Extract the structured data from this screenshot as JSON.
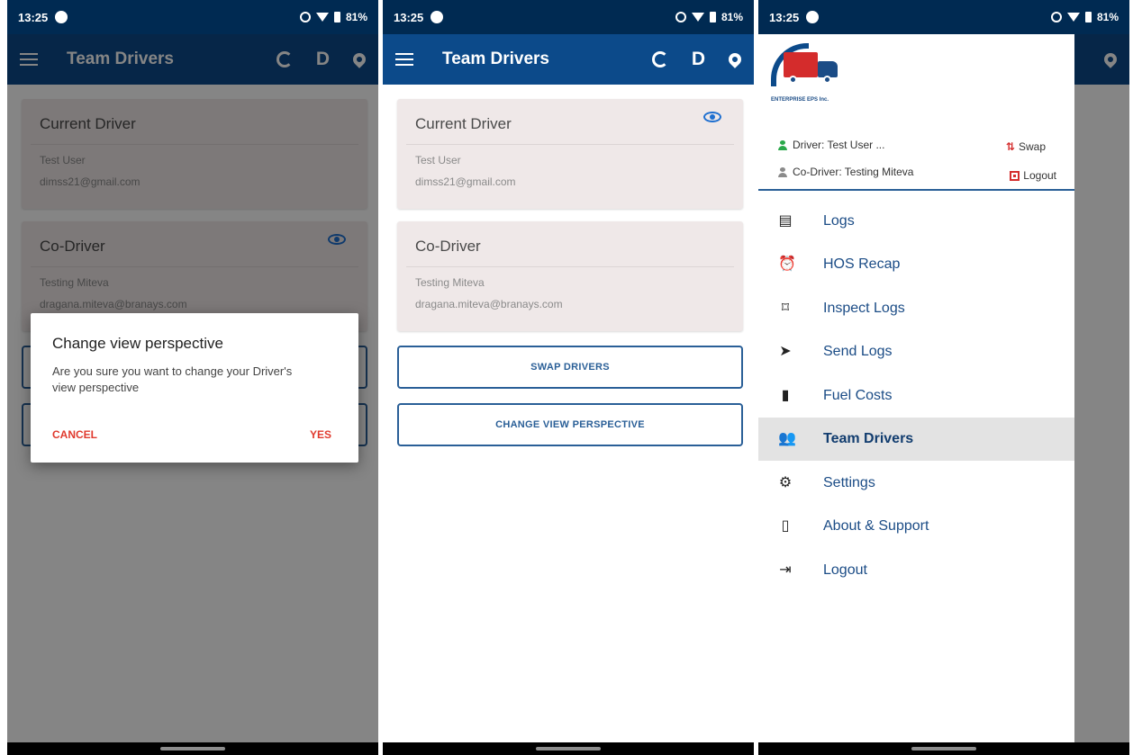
{
  "status": {
    "time": "13:25",
    "battery": "81%"
  },
  "panel1": {
    "appbar_title": "Team Drivers",
    "appbar_d": "D",
    "current_driver": {
      "title": "Current Driver",
      "name": "Test User",
      "email": "dimss21@gmail.com"
    },
    "co_driver": {
      "title": "Co-Driver",
      "name": "Testing Miteva",
      "email": "dragana.miteva@branays.com"
    },
    "dialog": {
      "title": "Change view perspective",
      "message": "Are you sure you want to change your Driver's view perspective",
      "cancel": "CANCEL",
      "yes": "YES"
    }
  },
  "panel2": {
    "appbar_title": "Team Drivers",
    "appbar_d": "D",
    "current_driver": {
      "title": "Current Driver",
      "name": "Test User",
      "email": "dimss21@gmail.com"
    },
    "co_driver": {
      "title": "Co-Driver",
      "name": "Testing Miteva",
      "email": "dragana.miteva@branays.com"
    },
    "swap_button": "SWAP DRIVERS",
    "change_view_button": "CHANGE VIEW PERSPECTIVE"
  },
  "panel3": {
    "company": "ENTERPRISE EPS Inc.",
    "driver": "Driver: Test User ...",
    "co_driver": "Co-Driver: Testing Miteva",
    "swap": "Swap",
    "logout_link": "Logout",
    "menu": [
      {
        "label": "Logs",
        "icon": "logs-icon"
      },
      {
        "label": "HOS Recap",
        "icon": "alarm-icon"
      },
      {
        "label": "Inspect Logs",
        "icon": "inspect-icon"
      },
      {
        "label": "Send Logs",
        "icon": "send-icon"
      },
      {
        "label": "Fuel Costs",
        "icon": "fuel-icon"
      },
      {
        "label": "Team Drivers",
        "icon": "team-icon"
      },
      {
        "label": "Settings",
        "icon": "gear-icon"
      },
      {
        "label": "About & Support",
        "icon": "phone-icon"
      },
      {
        "label": "Logout",
        "icon": "logout-icon"
      }
    ],
    "active_item": "Team Drivers"
  },
  "colors": {
    "statusbar": "#002a52",
    "appbar": "#0c4a8a",
    "accent_red": "#e03a2e",
    "eye_blue": "#1e6fd0"
  }
}
